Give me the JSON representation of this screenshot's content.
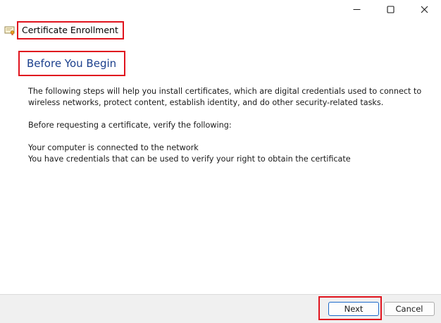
{
  "window": {
    "title": "Certificate Enrollment",
    "controls": {
      "minimize": "minimize-icon",
      "maximize": "maximize-icon",
      "close": "close-icon"
    }
  },
  "page": {
    "heading": "Before You Begin",
    "intro": "The following steps will help you install certificates, which are digital credentials used to connect to wireless networks, protect content, establish identity, and do other security-related tasks.",
    "verify_prompt": "Before requesting a certificate, verify the following:",
    "requirements": [
      "Your computer is connected to the network",
      "You have credentials that can be used to verify your right to obtain the certificate"
    ]
  },
  "footer": {
    "next_label": "Next",
    "cancel_label": "Cancel"
  },
  "colors": {
    "heading": "#1b3f8c",
    "highlight": "#e0141e",
    "footer_bg": "#f0f0f0"
  }
}
